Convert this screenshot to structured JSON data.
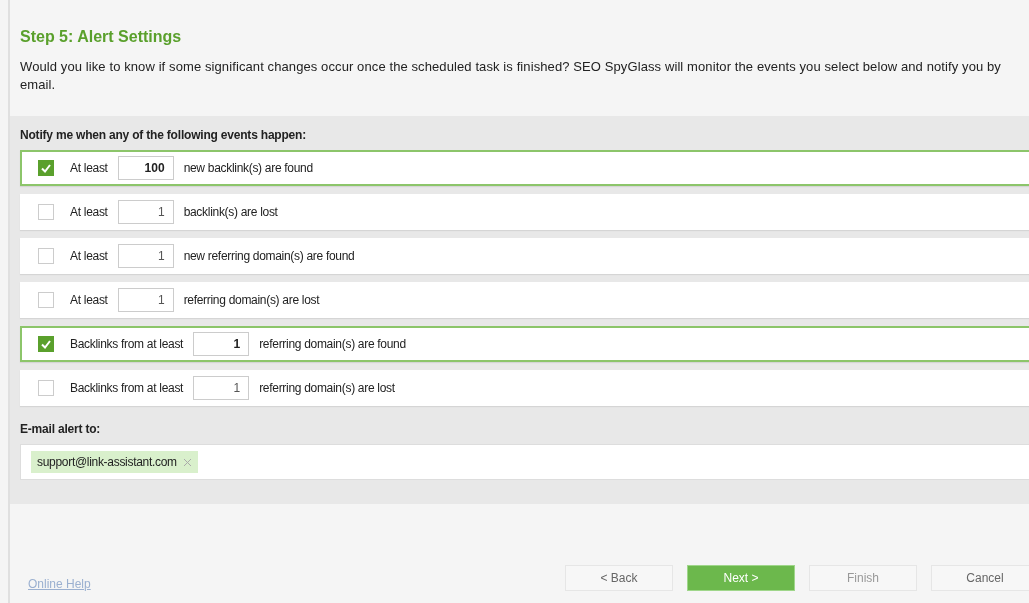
{
  "title": "Step 5: Alert Settings",
  "description": "Would you like to know if some significant changes occur once the scheduled task is finished? SEO SpyGlass will monitor the events you select below and notify you by email.",
  "events_heading": "Notify me when any of the following events happen:",
  "events": [
    {
      "checked": true,
      "prefix": "At least",
      "value": "100",
      "suffix": "new backlink(s) are found"
    },
    {
      "checked": false,
      "prefix": "At least",
      "value": "1",
      "suffix": "backlink(s) are lost"
    },
    {
      "checked": false,
      "prefix": "At least",
      "value": "1",
      "suffix": "new referring domain(s) are found"
    },
    {
      "checked": false,
      "prefix": "At least",
      "value": "1",
      "suffix": "referring domain(s) are lost"
    },
    {
      "checked": true,
      "prefix": "Backlinks from at least",
      "value": "1",
      "suffix": "referring domain(s) are found"
    },
    {
      "checked": false,
      "prefix": "Backlinks from at least",
      "value": "1",
      "suffix": "referring domain(s) are lost"
    }
  ],
  "email_heading": "E-mail alert to:",
  "emails": [
    "support@link-assistant.com"
  ],
  "help_link": "Online Help",
  "buttons": [
    {
      "label": "< Back",
      "kind": "normal",
      "disabled": false
    },
    {
      "label": "Next >",
      "kind": "primary",
      "disabled": false
    },
    {
      "label": "Finish",
      "kind": "normal",
      "disabled": true
    },
    {
      "label": "Cancel",
      "kind": "normal",
      "disabled": false
    }
  ]
}
